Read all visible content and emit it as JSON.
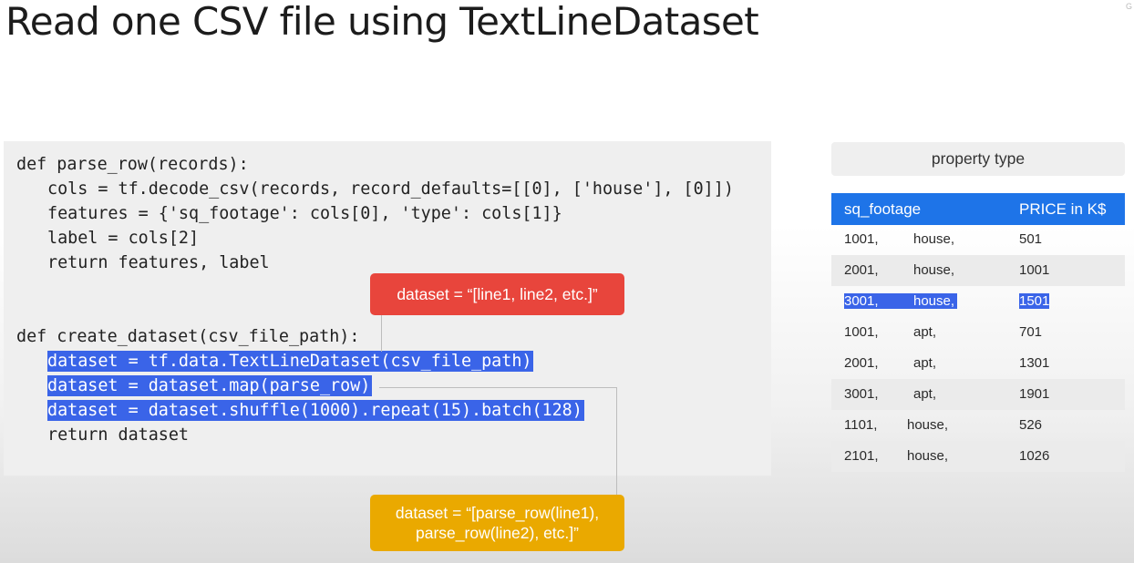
{
  "slide": {
    "title": "Read one CSV file using TextLineDataset",
    "corner_mark": "G"
  },
  "code": {
    "lines": [
      "def parse_row(records):",
      "cols = tf.decode_csv(records, record_defaults=[[0], ['house'], [0]])",
      "features = {'sq_footage': cols[0], 'type': cols[1]}",
      "label = cols[2]",
      "return features, label",
      "def create_dataset(csv_file_path):",
      "dataset = tf.data.TextLineDataset(csv_file_path)",
      "dataset = dataset.map(parse_row)",
      "dataset = dataset.shuffle(1000).repeat(15).batch(128)",
      "return dataset"
    ]
  },
  "callouts": {
    "red": "dataset = “[line1, line2, etc.]”",
    "gold_line1": "dataset = “[parse_row(line1),",
    "gold_line2": "parse_row(line2), etc.]”"
  },
  "table": {
    "group_header": "property type",
    "col_sq_footage": "sq_footage",
    "col_price": "PRICE in K$",
    "rows": [
      {
        "sq": "1001,",
        "type": "house,",
        "price": "501"
      },
      {
        "sq": "2001,",
        "type": "house,",
        "price": "1001"
      },
      {
        "sq": "3001,",
        "type": "house,",
        "price": "1501"
      },
      {
        "sq": "1001,",
        "type": "apt,",
        "price": "701"
      },
      {
        "sq": "2001,",
        "type": "apt,",
        "price": "1301"
      },
      {
        "sq": "3001,",
        "type": "apt,",
        "price": "1901"
      },
      {
        "sq": "1101,",
        "type": "house,",
        "price": "526"
      },
      {
        "sq": "2101,",
        "type": "house,",
        "price": "1026"
      }
    ]
  },
  "colors": {
    "selection_highlight": "#3a64e8",
    "table_header_blue": "#1e74e8",
    "callout_red": "#e8453c",
    "callout_gold": "#eaa900"
  }
}
